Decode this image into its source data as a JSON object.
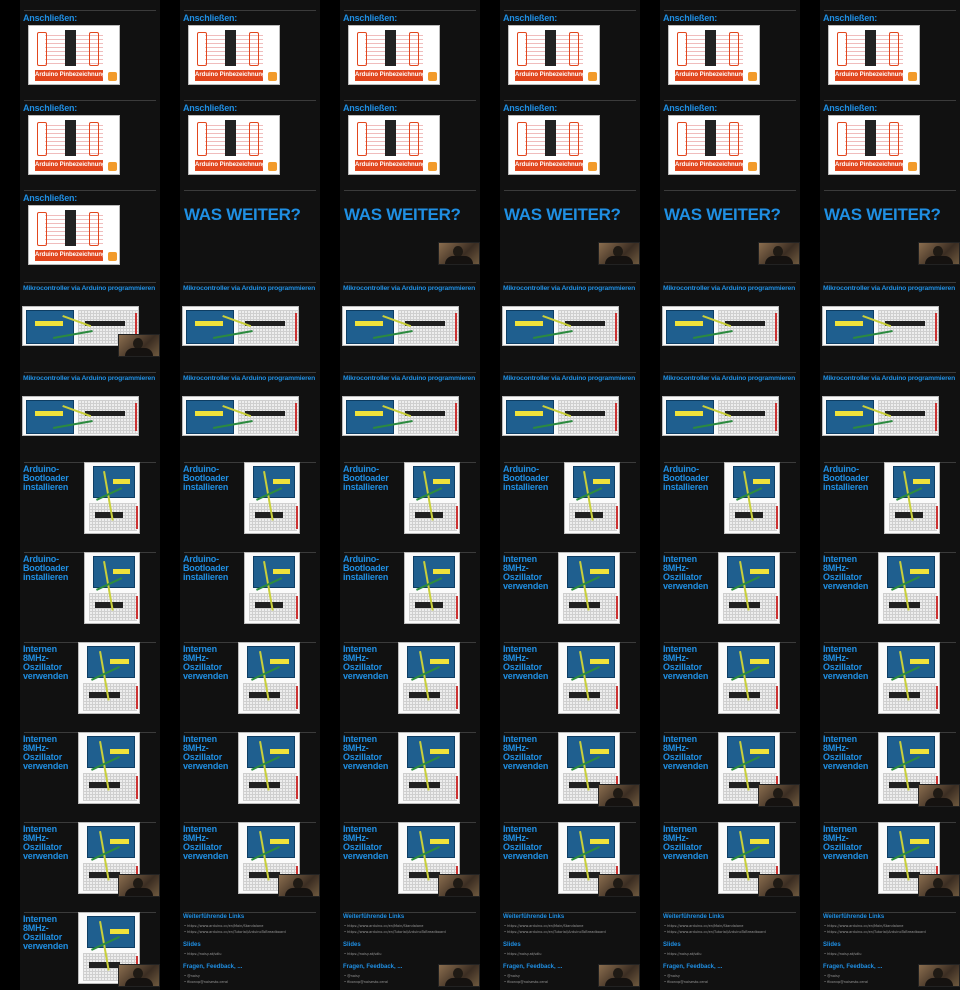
{
  "sheet": {
    "columns": 6,
    "rows": 11,
    "rows_per_column": [
      [
        "pin",
        "pin",
        "pin",
        "mcu",
        "mcu",
        "boot",
        "boot",
        "osc",
        "osc",
        "osc",
        "osc"
      ],
      [
        "pin",
        "pin",
        "was",
        "mcu",
        "mcu",
        "boot",
        "boot",
        "osc",
        "osc",
        "osc",
        "links"
      ],
      [
        "pin",
        "pin",
        "was",
        "mcu",
        "mcu",
        "boot",
        "boot",
        "osc",
        "osc",
        "osc",
        "links"
      ],
      [
        "pin",
        "pin",
        "was",
        "mcu",
        "mcu",
        "boot",
        "osc",
        "osc",
        "osc",
        "osc",
        "links"
      ],
      [
        "pin",
        "pin",
        "was",
        "mcu",
        "mcu",
        "boot",
        "osc",
        "osc",
        "osc",
        "osc",
        "links"
      ],
      [
        "pin",
        "pin",
        "was",
        "mcu",
        "mcu",
        "boot",
        "osc",
        "osc",
        "osc",
        "osc",
        "links"
      ]
    ],
    "webcam": [
      [
        false,
        false,
        false,
        true,
        false,
        false,
        false,
        false,
        false,
        true,
        true
      ],
      [
        false,
        false,
        false,
        false,
        false,
        false,
        false,
        false,
        false,
        true,
        false
      ],
      [
        false,
        false,
        true,
        false,
        false,
        false,
        false,
        false,
        false,
        true,
        true
      ],
      [
        false,
        false,
        true,
        false,
        false,
        false,
        false,
        false,
        true,
        true,
        true
      ],
      [
        false,
        false,
        true,
        false,
        false,
        false,
        false,
        false,
        true,
        true,
        false
      ],
      [
        false,
        false,
        true,
        false,
        false,
        false,
        false,
        false,
        true,
        true,
        true
      ]
    ]
  },
  "slides": {
    "pin": {
      "title": "Anschließen:",
      "banner": "Arduino Pinbezeichnungen"
    },
    "was": {
      "title": "WAS WEITER?"
    },
    "mcu": {
      "title": "Mikrocontroller via Arduino programmieren"
    },
    "boot": {
      "title": "Arduino-Bootloader installieren"
    },
    "osc": {
      "title": "Internen 8MHz-Oszillator verwenden"
    },
    "links": {
      "heading": "Weiterführende Links",
      "items": [
        "• https://www.arduino.cc/en/Main/Standalone",
        "• https://www.arduino.cc/en/Tutorial/ArduinoToBreadboard"
      ],
      "slides_heading": "Slides",
      "slides_item": "• https://noisy.at/sdlu",
      "questions_heading": "Fragen, Feedback, ...",
      "questions_items": [
        "• @noisy",
        "• fibonvp@noisesto.ceral"
      ]
    }
  },
  "colors": {
    "background": "#000000",
    "column": "#111111",
    "title": "#1f8fe3",
    "accent": "#e2471e",
    "board": "#1f5f8f"
  }
}
